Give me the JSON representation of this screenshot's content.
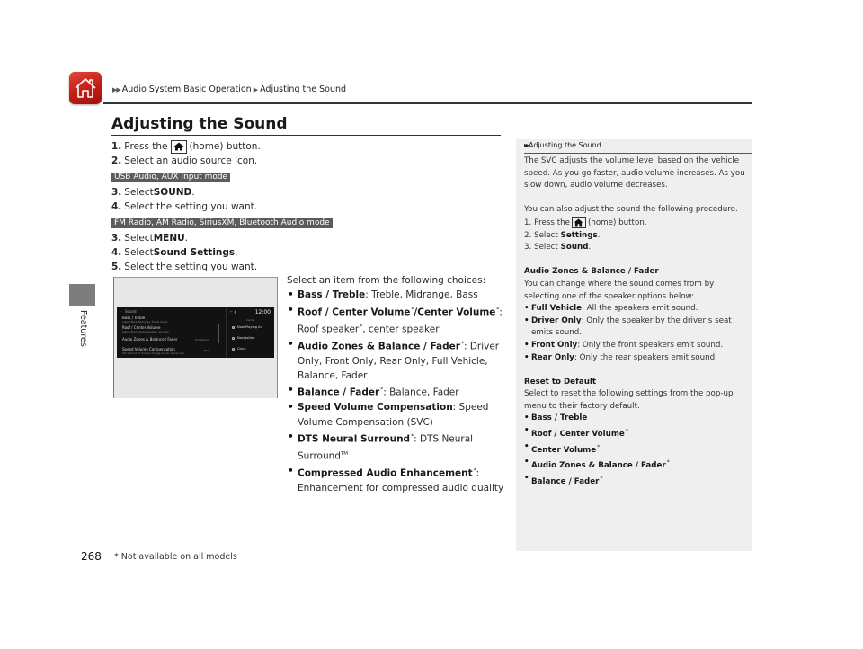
{
  "header": {
    "breadcrumb": [
      "Audio System Basic Operation",
      "Adjusting the Sound"
    ],
    "home_icon": "home-icon"
  },
  "page_title": "Adjusting the Sound",
  "section_tab": "Features",
  "steps_a": [
    {
      "num": "1.",
      "pre": "Press the",
      "post": "(home) button."
    },
    {
      "num": "2.",
      "text": "Select an audio source icon."
    }
  ],
  "mode_usb": "USB Audio, AUX Input mode",
  "steps_usb": [
    {
      "num": "3.",
      "pre": "Select ",
      "bold": "SOUND",
      "post": "."
    },
    {
      "num": "4.",
      "text": "Select the setting you want."
    }
  ],
  "mode_fm": "FM Radio, AM Radio, SiriusXM, Bluetooth Audio mode",
  "steps_fm": [
    {
      "num": "3.",
      "pre": "Select ",
      "bold": "MENU",
      "post": "."
    },
    {
      "num": "4.",
      "pre": "Select ",
      "bold": "Sound Settings",
      "post": "."
    },
    {
      "num": "5.",
      "text": "Select the setting you want."
    }
  ],
  "screen": {
    "header": "Sound",
    "clock": "12:00",
    "cards_label": "Cards",
    "items": [
      {
        "title": "Bass / Treble",
        "sub": "Adjust Bass, Midrange, Treble levels"
      },
      {
        "title": "Roof / Center  Volume",
        "sub": "Adjust Roof, Center  speaker volumes"
      },
      {
        "title": "Audio Zones & Balance / Fader",
        "value": "Full Vehicle"
      },
      {
        "title": "Speed Volume Compensation",
        "sub": "Set amount of volume change due to vehicle spe",
        "value": "Mid"
      }
    ],
    "right_items": [
      "Now Playing Au",
      "Navigation",
      "Clock"
    ]
  },
  "choices": {
    "lead": "Select an item from the following choices:",
    "items": [
      {
        "bold": "Bass / Treble",
        "text": ": Treble, Midrange, Bass"
      },
      {
        "bold": "Roof / Center Volume",
        "bold2": "/Center Volume",
        "text": ":",
        "text2": "Roof speaker",
        "text3": ", center speaker"
      },
      {
        "bold": "Audio Zones & Balance / Fader",
        "text": ": Driver Only, Front Only, Rear Only, Full Vehicle, Balance, Fader"
      },
      {
        "bold": "Balance / Fader",
        "text": ": Balance, Fader"
      },
      {
        "bold": "Speed Volume Compensation",
        "text": ": Speed Volume Compensation (SVC)"
      },
      {
        "bold": "DTS Neural Surround",
        "text": ": DTS Neural Surround",
        "tm": "TM"
      },
      {
        "bold": "Compressed Audio Enhancement",
        "text": ": Enhancement for compressed audio quality"
      }
    ],
    "asterisk": "*"
  },
  "sidebar": {
    "heading": "Adjusting the Sound",
    "para1": "The SVC adjusts the volume level based on the vehicle speed. As you go faster, audio volume increases. As you slow down, audio volume decreases.",
    "para2": "You can also adjust the sound the following procedure.",
    "steps": [
      {
        "num": "1.",
        "pre": "Press the",
        "post": "(home) button."
      },
      {
        "num": "2.",
        "pre": "Select ",
        "bold": "Settings",
        "post": "."
      },
      {
        "num": "3.",
        "pre": "Select ",
        "bold": "Sound",
        "post": "."
      }
    ],
    "zones_heading": "Audio Zones & Balance / Fader",
    "zones_text": "You can change where the sound comes from by selecting one of the speaker options below:",
    "zones_items": [
      {
        "bold": "Full Vehicle",
        "text": ": All the speakers emit sound."
      },
      {
        "bold": "Driver Only",
        "text": ": Only the speaker by the driver’s seat emits sound."
      },
      {
        "bold": "Front Only",
        "text": ": Only the front speakers emit sound."
      },
      {
        "bold": "Rear Only",
        "text": ": Only the rear speakers emit sound."
      }
    ],
    "reset_heading": "Reset to Default",
    "reset_text": "Select to reset the following settings from the pop-up menu to their factory default.",
    "reset_items": [
      "Bass / Treble",
      "Roof / Center Volume",
      "Center Volume",
      "Audio Zones & Balance / Fader",
      "Balance / Fader"
    ]
  },
  "footer": {
    "page_number": "268",
    "footnote": "* Not available on all models"
  }
}
